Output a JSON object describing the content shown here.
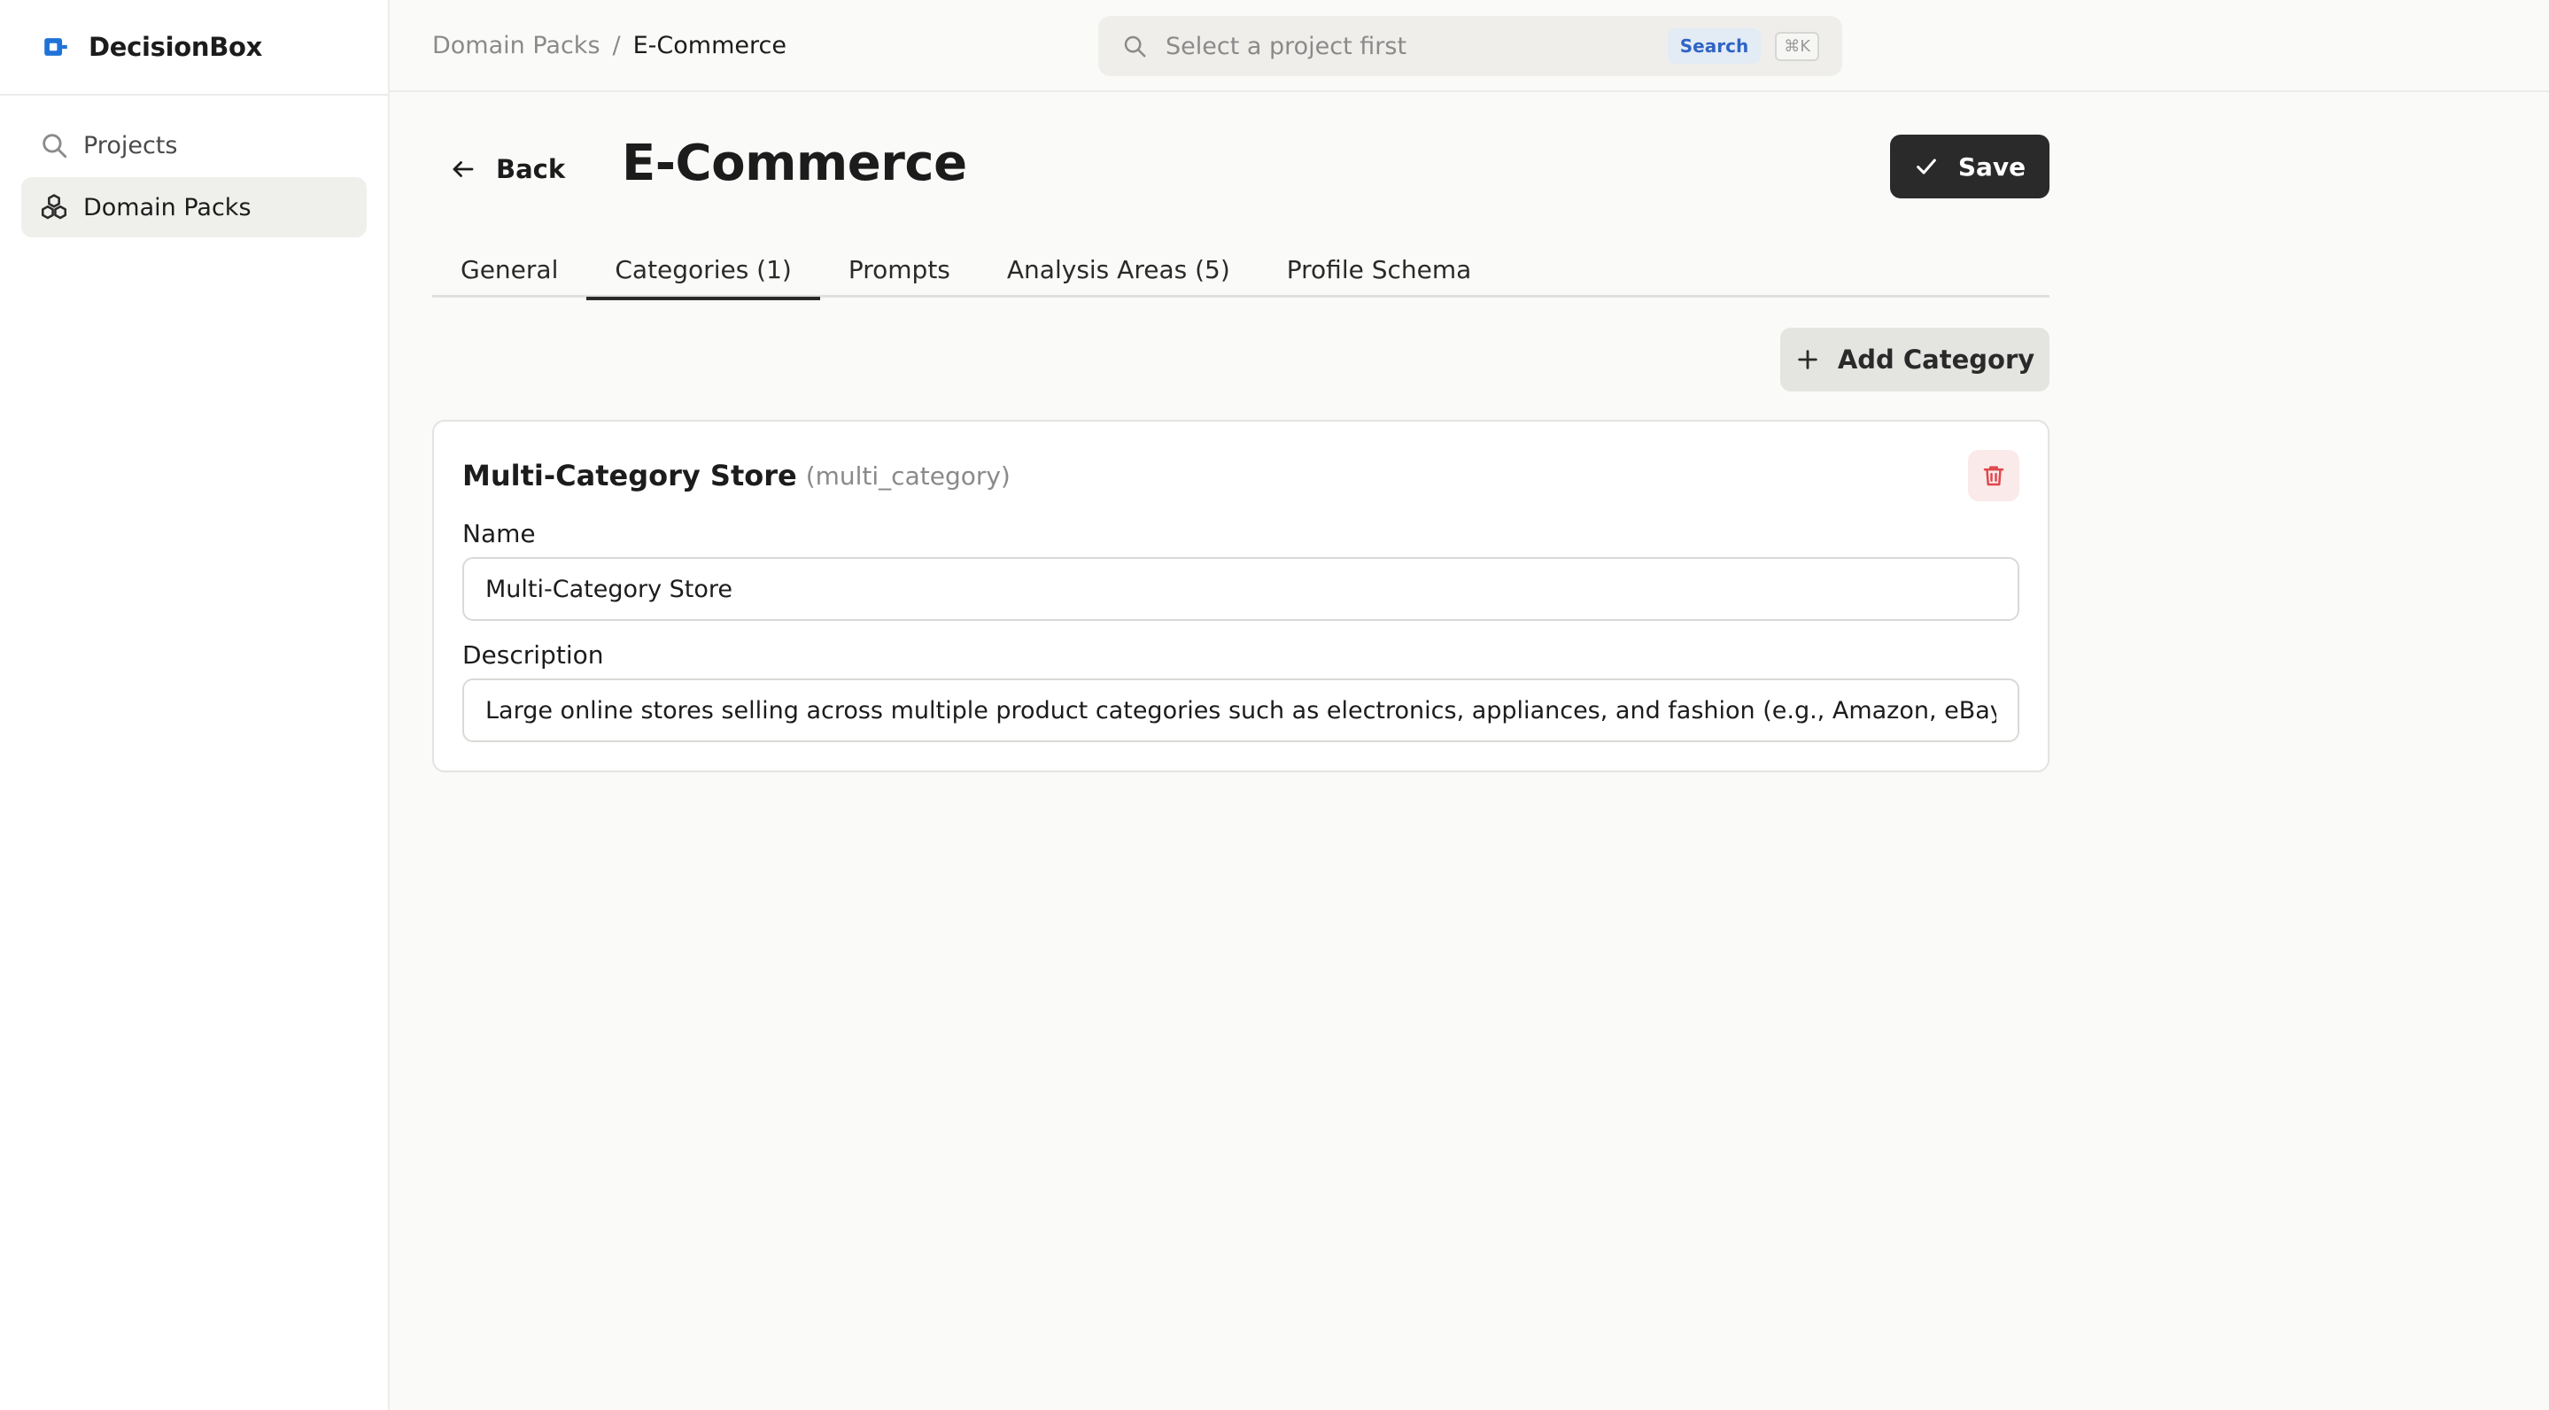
{
  "app": {
    "name": "DecisionBox"
  },
  "sidebar": {
    "items": [
      {
        "label": "Projects",
        "icon": "search-icon",
        "active": false
      },
      {
        "label": "Domain Packs",
        "icon": "domain-packs-icon",
        "active": true
      }
    ]
  },
  "topbar": {
    "breadcrumb": {
      "parent": "Domain Packs",
      "separator": "/",
      "current": "E-Commerce"
    },
    "search": {
      "placeholder": "Select a project first",
      "badge": "Search",
      "shortcut": "⌘K"
    }
  },
  "header": {
    "back_label": "Back",
    "title": "E-Commerce",
    "save_label": "Save"
  },
  "tabs": [
    {
      "label": "General",
      "active": false
    },
    {
      "label": "Categories (1)",
      "active": true
    },
    {
      "label": "Prompts",
      "active": false
    },
    {
      "label": "Analysis Areas (5)",
      "active": false
    },
    {
      "label": "Profile Schema",
      "active": false
    }
  ],
  "toolbar": {
    "add_label": "Add Category"
  },
  "category": {
    "title": "Multi-Category Store",
    "key": "(multi_category)",
    "name_label": "Name",
    "name_value": "Multi-Category Store",
    "description_label": "Description",
    "description_value": "Large online stores selling across multiple product categories such as electronics, appliances, and fashion (e.g., Amazon, eBay, Ozon)"
  },
  "colors": {
    "accent_dark": "#2a2a2a",
    "brand_blue": "#1f73d6",
    "delete_red": "#e0474c",
    "badge_blue": "#2f64c4"
  }
}
